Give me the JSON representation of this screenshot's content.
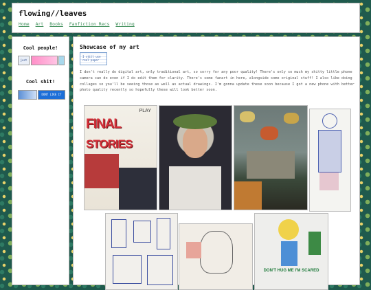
{
  "header": {
    "title": "flowing//leaves",
    "nav": [
      "Home",
      "Art",
      "Books",
      "Fanfiction Recs",
      "Writing"
    ]
  },
  "sidebar": {
    "cool_people_heading": "Cool people!",
    "cool_shit_heading": "Cool shit!",
    "button_left_text": "ject",
    "button_dont_like": "DONT LIKE IT"
  },
  "main": {
    "post_title": "Showcase of my art",
    "stamp_text": "I still use real paper",
    "post_body": "I don't really do digital art, only traditional art, so sorry for any poor quality! There's only so much my shitty little phone camera can do even if I do edit them for clarity. There's some fanart in here, alongside some original stuff! I also like doing collages so you'll be seeing those as well as actual drawings. I'm gonna update these soon because I got a new phone with better photo quality recently so hopefully these will look better soon.",
    "art_captions": {
      "final": "FINAL",
      "stories": "STORIES",
      "play": "PLAY",
      "hug": "DON'T HUG ME I'M SCARED"
    }
  }
}
